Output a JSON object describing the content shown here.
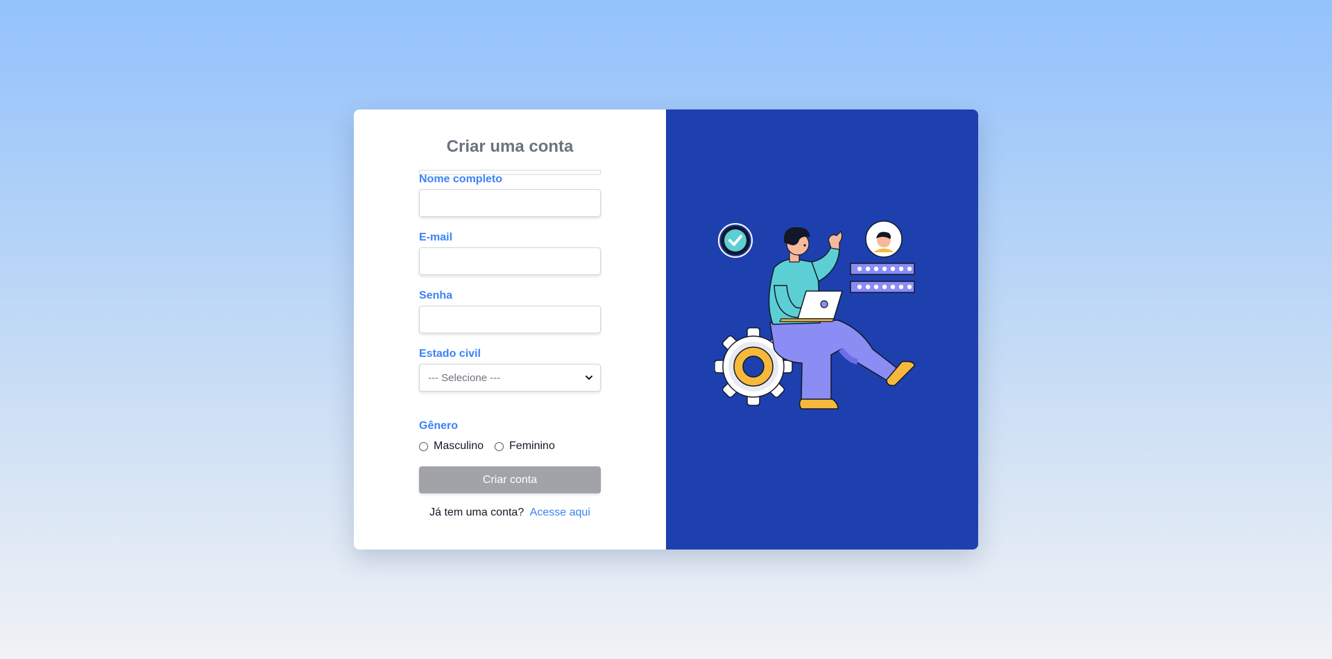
{
  "form": {
    "title": "Criar uma conta",
    "fields": {
      "name_label": "Nome completo",
      "email_label": "E-mail",
      "password_label": "Senha",
      "marital_label": "Estado civil",
      "marital_selected": "--- Selecione ---",
      "gender_label": "Gênero"
    },
    "gender_options": [
      "Masculino",
      "Feminino"
    ],
    "submit_label": "Criar conta",
    "login_prompt": "Já tem uma conta?",
    "login_link": "Acesse aqui"
  },
  "illustration": {
    "icons": [
      "checkmark-badge-icon",
      "user-avatar-icon",
      "password-field-icon",
      "gear-icon",
      "laptop-icon"
    ]
  },
  "colors": {
    "accent": "#3b82f6",
    "panel": "#1e40af",
    "button": "#a1a3a9",
    "title": "#6b7280"
  }
}
